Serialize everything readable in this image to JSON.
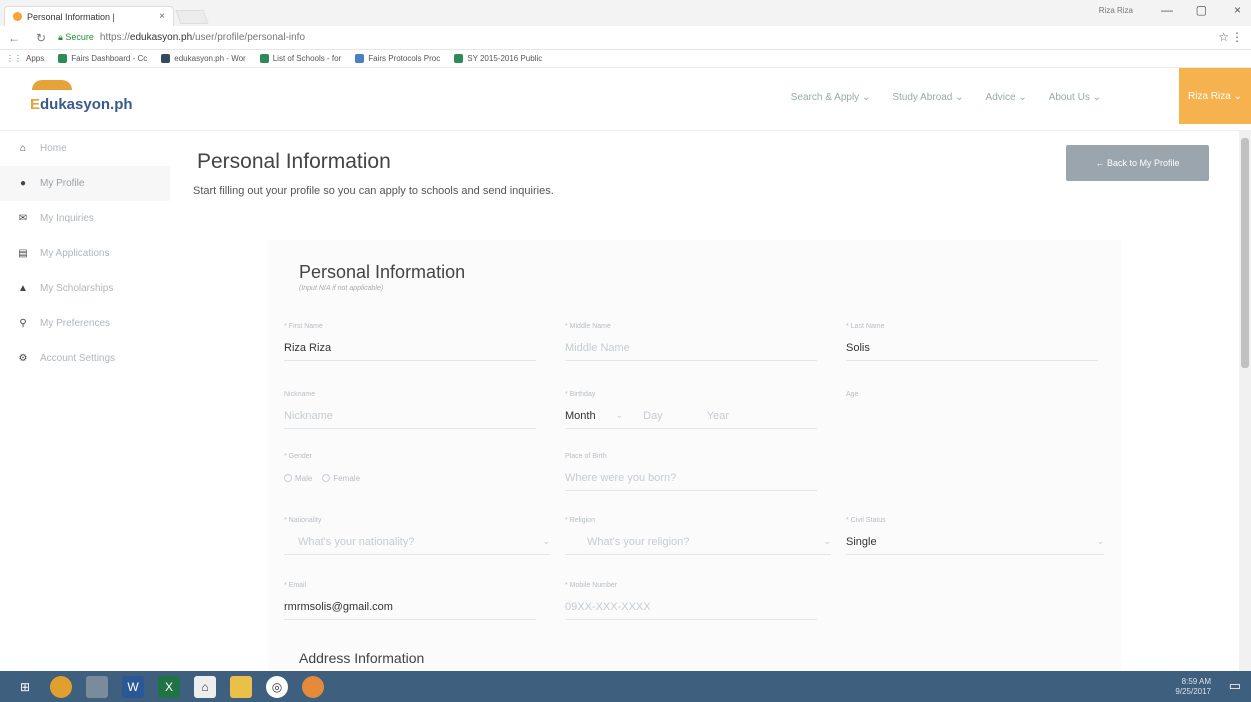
{
  "browser": {
    "tab_title": "Personal Information |",
    "tab_close": "×",
    "user_label": "Riza Riza",
    "window_minimize": "—",
    "window_restore": "▢",
    "window_close": "×",
    "secure_label": "Secure",
    "url_prefix": "https://",
    "url_host": "edukasyon.ph",
    "url_path": "/user/profile/personal-info",
    "bookmarks": [
      "Apps",
      "Fairs Dashboard - Cc",
      "edukasyon.ph - Wor",
      "List of Schools - for",
      "Fairs Protocols Proc",
      "SY 2015-2016 Public"
    ]
  },
  "site": {
    "logo_text_e": "E",
    "logo_text_rest": "dukasyon.ph",
    "nav": [
      "Search & Apply ⌄",
      "Study Abroad ⌄",
      "Advice ⌄",
      "About Us ⌄"
    ],
    "user_menu": "Riza Riza ⌄"
  },
  "sidebar": {
    "items": [
      {
        "icon": "home-icon",
        "label": "Home"
      },
      {
        "icon": "user-icon",
        "label": "My Profile"
      },
      {
        "icon": "chat-icon",
        "label": "My Inquiries"
      },
      {
        "icon": "applications-icon",
        "label": "My Applications"
      },
      {
        "icon": "graduation-cap-icon",
        "label": "My Scholarships"
      },
      {
        "icon": "search-icon",
        "label": "My Preferences"
      },
      {
        "icon": "gear-icon",
        "label": "Account Settings"
      }
    ]
  },
  "page": {
    "title": "Personal Information",
    "subtitle": "Start filling out your profile so you can apply to schools and send inquiries.",
    "back_button": "← Back to My Profile"
  },
  "form": {
    "title": "Personal Information",
    "note": "(Input N/A if not applicable)",
    "first_name": {
      "label": "* First Name",
      "value": "Riza Riza"
    },
    "middle_name": {
      "label": "* Middle Name",
      "placeholder": "Middle Name"
    },
    "last_name": {
      "label": "* Last Name",
      "value": "Solis"
    },
    "nickname": {
      "label": "Nickname",
      "placeholder": "Nickname"
    },
    "birthday": {
      "label": "* Birthday",
      "month": "Month",
      "day": "Day",
      "year": "Year"
    },
    "age": {
      "label": "Age"
    },
    "gender": {
      "label": "* Gender",
      "male": "Male",
      "female": "Female"
    },
    "place_of_birth": {
      "label": "Place of Birth",
      "placeholder": "Where were you born?"
    },
    "nationality": {
      "label": "* Nationality",
      "placeholder": "What's your nationality?"
    },
    "religion": {
      "label": "* Religion",
      "placeholder": "What's your religion?"
    },
    "civil_status": {
      "label": "* Civil Status",
      "value": "Single"
    },
    "email": {
      "label": "* Email",
      "value": "rmrmsolis@gmail.com"
    },
    "mobile": {
      "label": "* Mobile Number",
      "placeholder": "09XX-XXX-XXXX"
    },
    "address_heading": "Address Information"
  },
  "taskbar": {
    "time": "8:59 AM",
    "date": "9/25/2017"
  }
}
